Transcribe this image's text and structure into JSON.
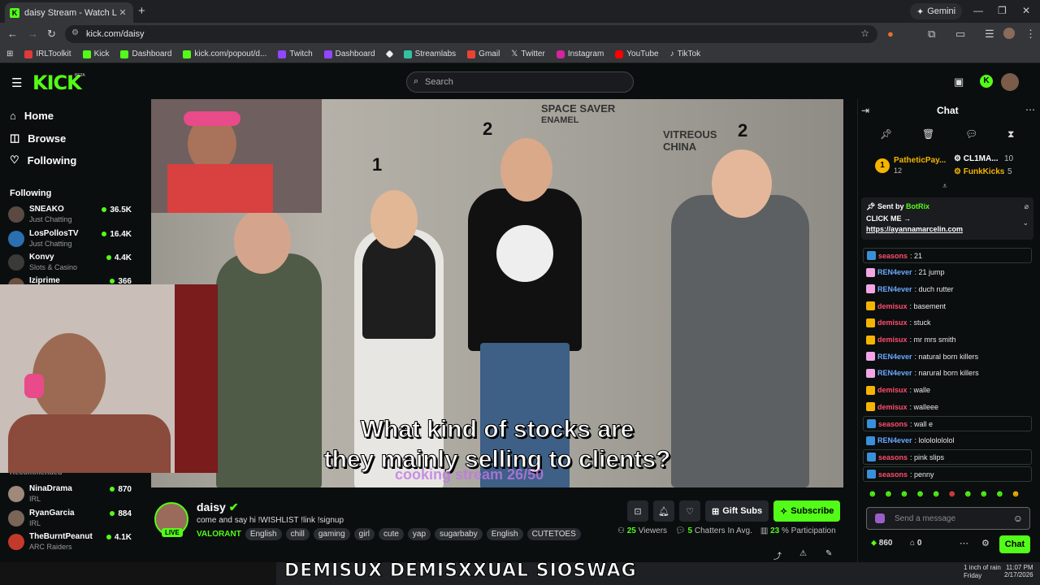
{
  "browser": {
    "tab_title": "daisy Stream - Watch Live on K",
    "tab_close": "✕",
    "new_tab": "+",
    "gemini_label": "Gemini",
    "url": "kick.com/daisy",
    "bookmarks": [
      "IRLToolkit",
      "Kick",
      "Dashboard",
      "kick.com/popout/d...",
      "Twitch",
      "Dashboard",
      "",
      "Streamlabs",
      "Gmail",
      "Twitter",
      "Instagram",
      "YouTube",
      "TikTok"
    ]
  },
  "header": {
    "logo": "KICK",
    "beta": "BETA",
    "search_placeholder": "Search"
  },
  "sidebar": {
    "nav": [
      "Home",
      "Browse",
      "Following"
    ],
    "following_heading": "Following",
    "channels_top": [
      {
        "name": "SNEAKO",
        "category": "Just Chatting",
        "viewers": "36.5K"
      },
      {
        "name": "LosPollosTV",
        "category": "Just Chatting",
        "viewers": "16.4K"
      },
      {
        "name": "Konvy",
        "category": "Slots & Casino",
        "viewers": "4.4K"
      },
      {
        "name": "Iziprime",
        "category": "",
        "viewers": "366"
      }
    ],
    "recommended_heading": "Recommended",
    "channels_bottom": [
      {
        "name": "NinaDrama",
        "category": "IRL",
        "viewers": "870"
      },
      {
        "name": "RyanGarcia",
        "category": "IRL",
        "viewers": "884"
      },
      {
        "name": "TheBurntPeanut",
        "category": "ARC Raiders",
        "viewers": "4.1K"
      }
    ]
  },
  "video": {
    "numbers": [
      "1",
      "2",
      "2"
    ],
    "caption_line1": "What kind of stocks are",
    "caption_line2": "they mainly selling to clients?",
    "overlay_text": "cooking stream 26/50",
    "wall_text1": "SPACE SAVER",
    "wall_text2": "ENAMEL",
    "wall_text3": "VITREOUS CHINA"
  },
  "stream": {
    "name": "daisy",
    "live": "LIVE",
    "title": "come and say hi !WISHLIST !link !signup",
    "category": "VALORANT",
    "tags": [
      "English",
      "chill",
      "gaming",
      "girl",
      "cute",
      "yap",
      "sugarbaby",
      "English",
      "CUTETOES"
    ],
    "gift_label": "Gift Subs",
    "subscribe_label": "Subscribe",
    "viewers": "25",
    "viewers_label": "Viewers",
    "chatters": "5",
    "chatters_label": "Chatters In Avg.",
    "participation": "23",
    "participation_label": "% Participation"
  },
  "chat": {
    "title": "Chat",
    "leaders": [
      {
        "name": "PatheticPay...",
        "count": "12"
      },
      {
        "name": "CL1MA...",
        "count": "10"
      },
      {
        "name": "FunkKicks",
        "count": "5"
      }
    ],
    "pinned_sender_prefix": "Sent by",
    "pinned_sender": "BotRix",
    "pinned_line1": "CLICK ME →",
    "pinned_link": "https://ayannamarcelin.com",
    "messages": [
      {
        "user": "seasons",
        "text": ": 21",
        "color": "#ff4d6d",
        "badge": "#3a8fd9",
        "hl": true
      },
      {
        "user": "REN4ever",
        "text": ": 21 jump",
        "color": "#6aa8ff",
        "badge": "#f2a6e6",
        "hl": false
      },
      {
        "user": "REN4ever",
        "text": ": duch rutter",
        "color": "#6aa8ff",
        "badge": "#f2a6e6",
        "hl": false
      },
      {
        "user": "demisux",
        "text": ": basement",
        "color": "#ff4d6d",
        "badge": "#f5b400",
        "hl": false
      },
      {
        "user": "demisux",
        "text": ": stuck",
        "color": "#ff4d6d",
        "badge": "#f5b400",
        "hl": false
      },
      {
        "user": "demisux",
        "text": ": mr mrs smith",
        "color": "#ff4d6d",
        "badge": "#f5b400",
        "hl": false
      },
      {
        "user": "REN4ever",
        "text": ": natural born killers",
        "color": "#6aa8ff",
        "badge": "#f2a6e6",
        "hl": false
      },
      {
        "user": "REN4ever",
        "text": ": narural born killers",
        "color": "#6aa8ff",
        "badge": "#f2a6e6",
        "hl": false
      },
      {
        "user": "demisux",
        "text": ": walle",
        "color": "#ff4d6d",
        "badge": "#f5b400",
        "hl": false
      },
      {
        "user": "demisux",
        "text": ": walleee",
        "color": "#ff4d6d",
        "badge": "#f5b400",
        "hl": false
      },
      {
        "user": "seasons",
        "text": ": wall e",
        "color": "#ff4d6d",
        "badge": "#3a8fd9",
        "hl": true
      },
      {
        "user": "REN4ever",
        "text": ": lolololololol",
        "color": "#6aa8ff",
        "badge": "#3a8fd9",
        "hl": false
      },
      {
        "user": "seasons",
        "text": ": pink slips",
        "color": "#ff4d6d",
        "badge": "#3a8fd9",
        "hl": true
      },
      {
        "user": "seasons",
        "text": ": penny",
        "color": "#ff4d6d",
        "badge": "#3a8fd9",
        "hl": true
      }
    ],
    "input_placeholder": "Send a message",
    "points": "860",
    "second_count": "0",
    "send_label": "Chat"
  },
  "banner": {
    "text": "DEMISUX DEMISXXUAL SIOSWAG"
  },
  "taskbar": {
    "weather_line1": "1 inch of rain",
    "weather_line2": "Friday",
    "time": "11:07 PM",
    "date": "2/17/2026"
  },
  "colors": {
    "brand": "#53fc18",
    "bg": "#0b0e0f"
  }
}
